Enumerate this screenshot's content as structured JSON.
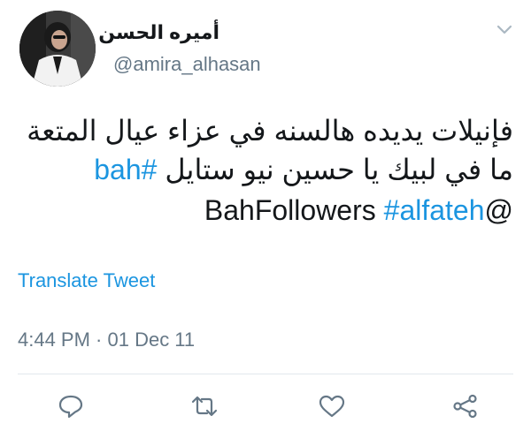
{
  "user": {
    "display_name": "أميره الحسن",
    "handle": "@amira_alhasan"
  },
  "tweet": {
    "line1": "فإنيلات يديده هالسنه في عزاء عيال المتعة",
    "line2_text": "ما في لبيك يا حسين نيو ستايل ",
    "line2_hashtag": "#bah",
    "line3_mention": "@BahFollowers",
    "line3_hashtag": "#alfateh"
  },
  "translate_label": "Translate Tweet",
  "timestamp": "4:44 PM · 01 Dec 11",
  "icons": {
    "menu": "chevron-down-icon",
    "reply": "reply-icon",
    "retweet": "retweet-icon",
    "like": "heart-icon",
    "share": "share-icon"
  },
  "colors": {
    "link": "#1b95e0",
    "muted": "#657786",
    "text": "#14171a",
    "divider": "#e1e8ed"
  }
}
